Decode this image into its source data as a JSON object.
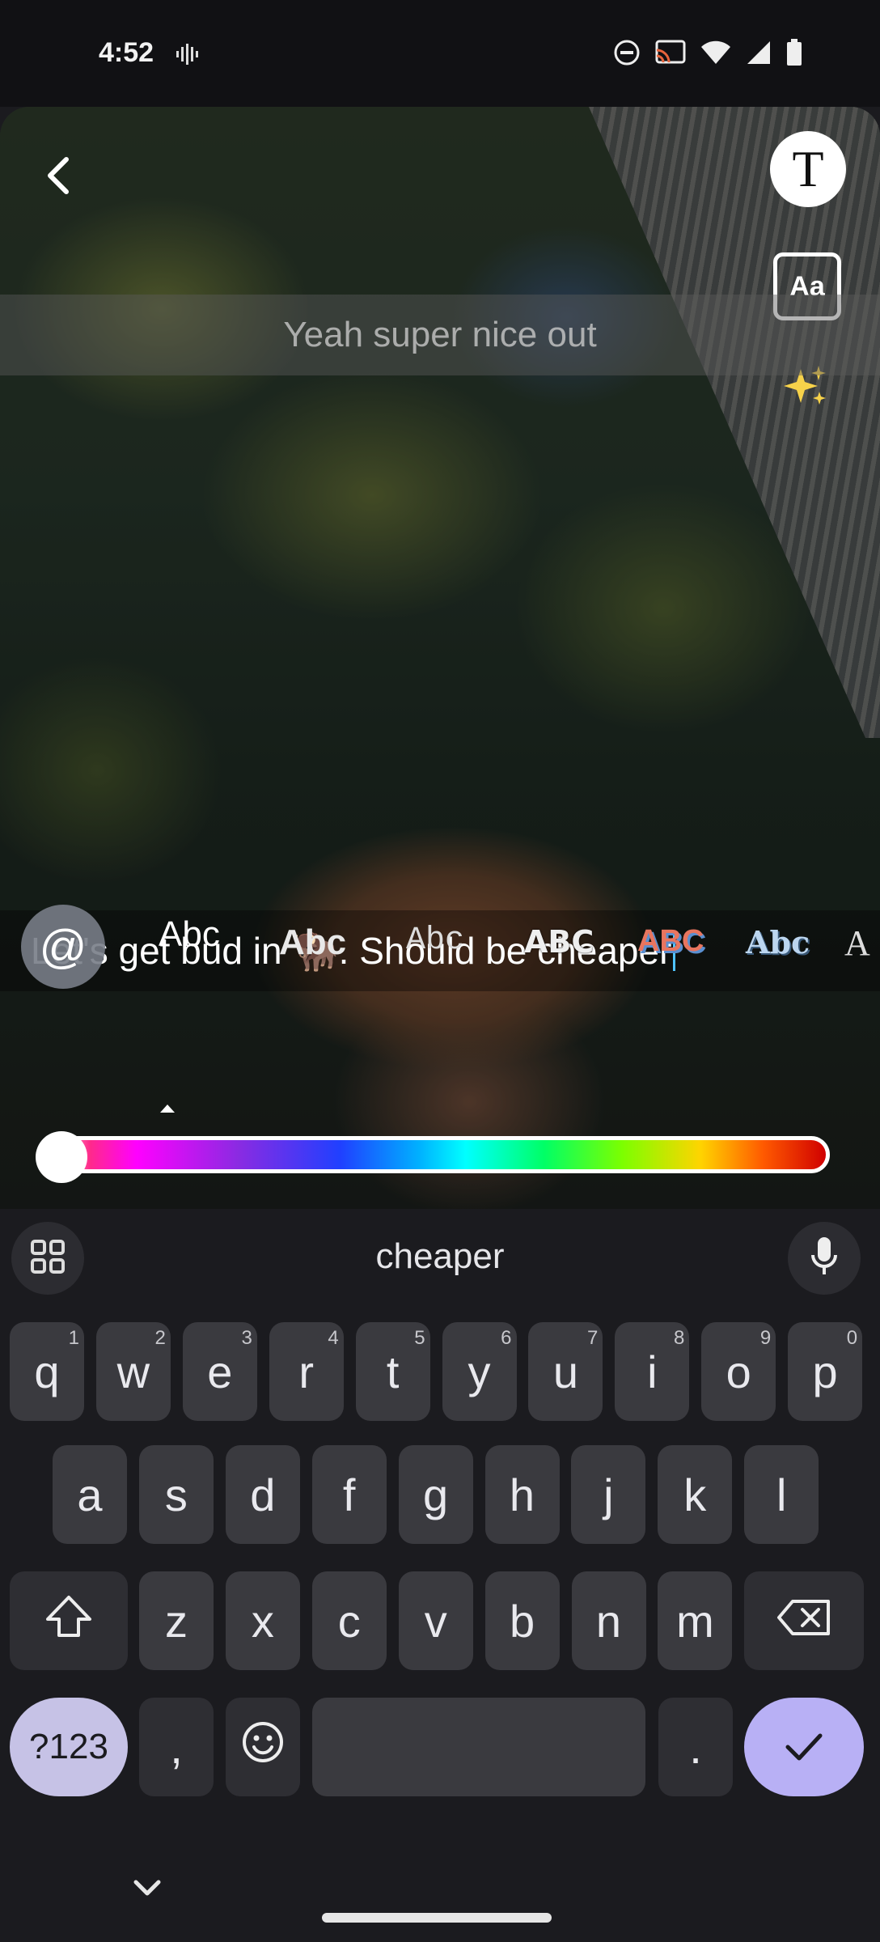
{
  "status_bar": {
    "time": "4:52"
  },
  "editor": {
    "caption_overlay": "Yeah super nice out",
    "edit_text_before": "Let's get bud in ",
    "edit_emoji": "🦬",
    "edit_text_after": ". Should be cheaper",
    "tools": {
      "text_style_label": "T",
      "font_label": "Aa"
    },
    "mention_label": "@",
    "text_styles": [
      "Abc",
      "Abc",
      "Abc",
      "ABC",
      "ABC",
      "Abc",
      "A"
    ],
    "color_slider_value": 0.0
  },
  "keyboard": {
    "suggestion": "cheaper",
    "row1": [
      {
        "k": "q",
        "h": "1"
      },
      {
        "k": "w",
        "h": "2"
      },
      {
        "k": "e",
        "h": "3"
      },
      {
        "k": "r",
        "h": "4"
      },
      {
        "k": "t",
        "h": "5"
      },
      {
        "k": "y",
        "h": "6"
      },
      {
        "k": "u",
        "h": "7"
      },
      {
        "k": "i",
        "h": "8"
      },
      {
        "k": "o",
        "h": "9"
      },
      {
        "k": "p",
        "h": "0"
      }
    ],
    "row2": [
      "a",
      "s",
      "d",
      "f",
      "g",
      "h",
      "j",
      "k",
      "l"
    ],
    "row3": [
      "z",
      "x",
      "c",
      "v",
      "b",
      "n",
      "m"
    ],
    "symbols_label": "?123",
    "comma_label": ",",
    "period_label": "."
  }
}
